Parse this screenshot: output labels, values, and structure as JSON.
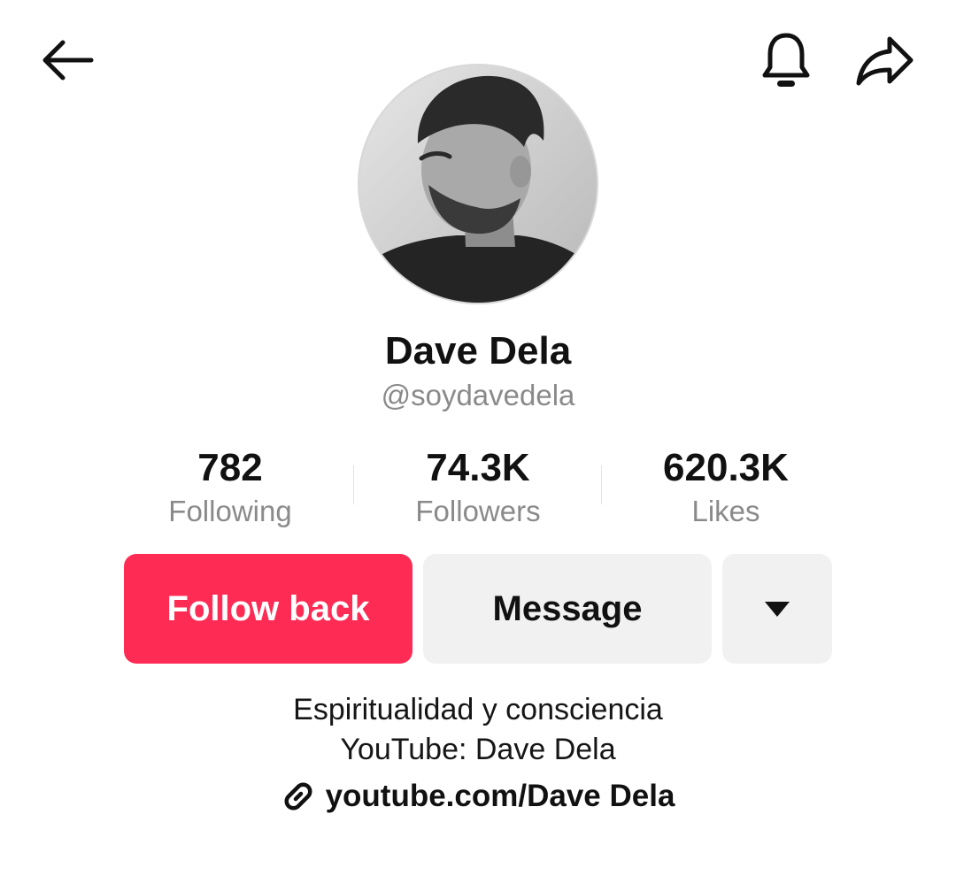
{
  "header": {
    "back_icon": "back-arrow-icon",
    "notification_icon": "bell-icon",
    "share_icon": "share-icon"
  },
  "profile": {
    "name": "Dave Dela",
    "handle": "@soydavedela",
    "avatar_icon": "profile-photo"
  },
  "stats": [
    {
      "value": "782",
      "label": "Following"
    },
    {
      "value": "74.3K",
      "label": "Followers"
    },
    {
      "value": "620.3K",
      "label": "Likes"
    }
  ],
  "actions": {
    "follow_label": "Follow back",
    "message_label": "Message",
    "more_icon": "caret-down-icon"
  },
  "bio": {
    "line1": "Espiritualidad y consciencia",
    "line2": "YouTube: Dave Dela"
  },
  "link": {
    "icon": "link-icon",
    "text": "youtube.com/Dave Dela"
  },
  "colors": {
    "accent": "#fe2c55",
    "secondary_button": "#f1f1f2",
    "muted_text": "#8a8a8a"
  }
}
